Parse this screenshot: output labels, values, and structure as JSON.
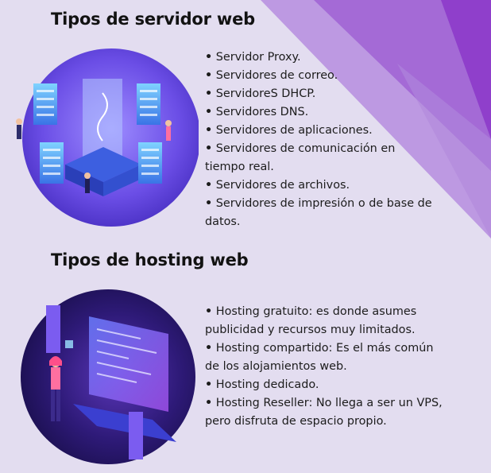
{
  "sections": [
    {
      "title": "Tipos de servidor web",
      "items": [
        "Servidor Proxy.",
        "Servidores de correo.",
        "ServidoreS DHCP.",
        "Servidores DNS.",
        "Servidores de aplicaciones.",
        "Servidores de comunicación en tiempo real.",
        "Servidores de archivos.",
        "Servidores de impresión o de base de datos."
      ]
    },
    {
      "title": "Tipos de hosting web",
      "items": [
        "Hosting gratuito: es donde asumes publicidad y recursos muy limitados.",
        "Hosting compartido: Es el más común de los alojamientos web.",
        "Hosting dedicado.",
        "Hosting Reseller: No llega a ser un VPS, pero disfruta de espacio propio."
      ]
    }
  ],
  "bullet": "•",
  "colors": {
    "background": "#e3ddf0",
    "accent_dark": "#8e3fc9",
    "accent_light": "#b188dc",
    "heading": "#121212",
    "text": "#1c1c1c"
  },
  "icons": [
    "server-network-illustration",
    "hosting-developer-illustration"
  ]
}
